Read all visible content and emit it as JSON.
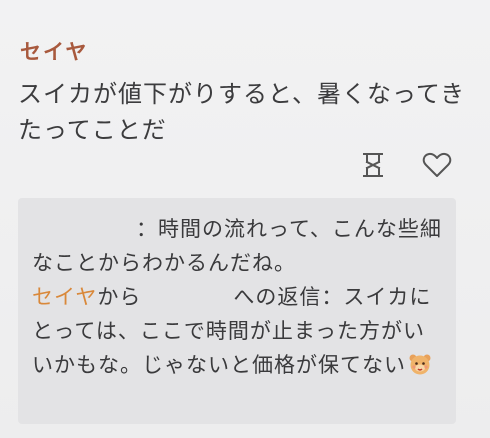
{
  "post": {
    "author": "セイヤ",
    "message": "スイカが値下がりすると、暑くなってきたってことだ"
  },
  "actions": {
    "hourglass_icon": "hourglass-icon",
    "like_icon": "heart-icon"
  },
  "replies": [
    {
      "quoted_text": "：時間の流れって、こんな些細なことからわかるんだね。"
    },
    {
      "from_name": "セイヤ",
      "from_suffix": "から",
      "to_suffix": "への返信：",
      "text": "スイカにとっては、ここで時間が止まった方がいいかもな。じゃないと価格が保てない",
      "emoji": "bear-emoji"
    }
  ]
}
